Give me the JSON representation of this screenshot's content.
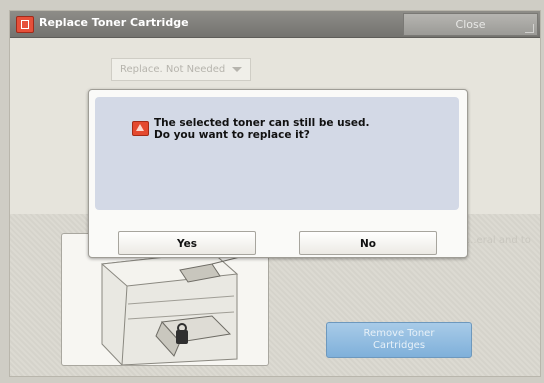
{
  "window": {
    "title": "Replace Toner Cartridge",
    "close_label": "Close"
  },
  "background": {
    "replace_dropdown_value": "Replace. Not Needed",
    "remove_button_label_line1": "Remove Toner",
    "remove_button_label_line2": "Cartridges",
    "hint_text": "...eral and to"
  },
  "dialog": {
    "message_line1": "The selected toner can still be used.",
    "message_line2": "Do you want to replace it?",
    "yes_label": "Yes",
    "no_label": "No"
  },
  "colors": {
    "title_bar": "#74736f",
    "dialog_message_area": "#d3d9e6",
    "warning_icon": "#e4492f",
    "remove_button": "#7fb0da"
  },
  "icons": {
    "title": "toner-cartridge-icon",
    "warning": "warning-triangle-icon",
    "dropdown": "chevron-down-icon"
  }
}
